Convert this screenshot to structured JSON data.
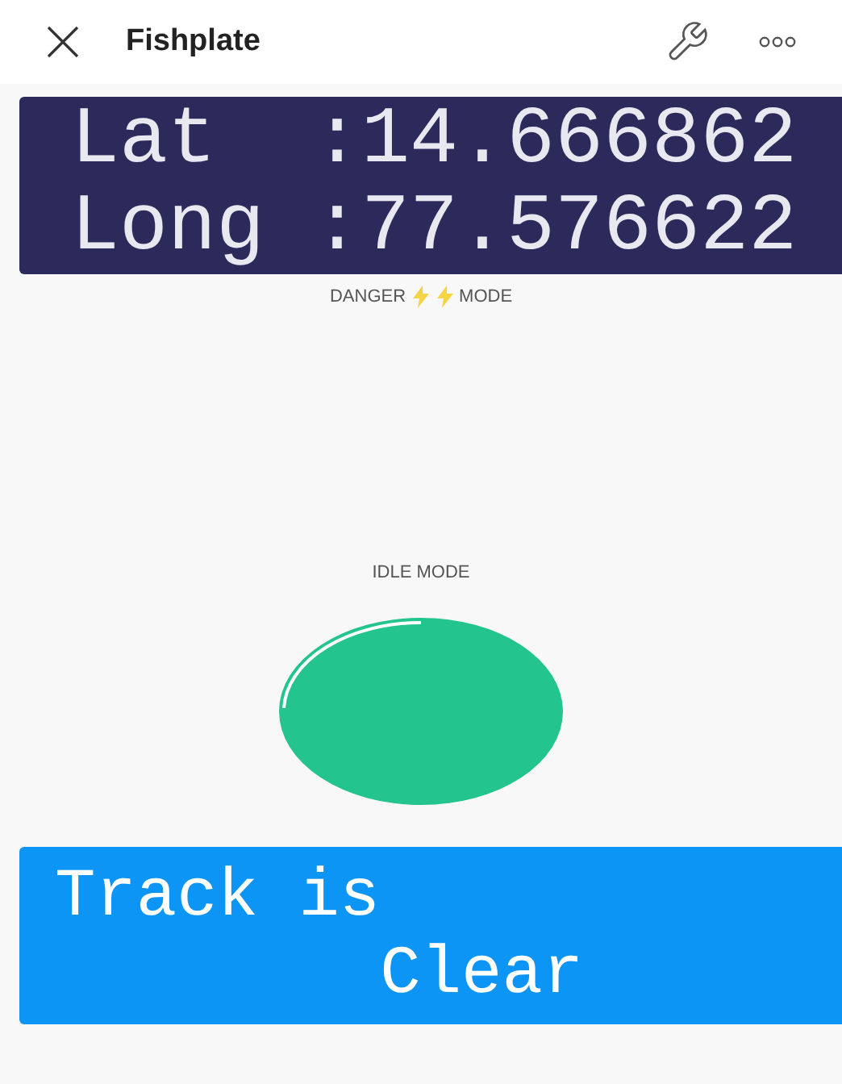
{
  "header": {
    "title": "Fishplate"
  },
  "location_display": {
    "lines": [
      "Lat  :14.666862",
      "Long :77.576622"
    ]
  },
  "danger_led": {
    "label_start": "DANGER",
    "label_end": "MODE"
  },
  "idle_led": {
    "label": "IDLE MODE",
    "color": "#23c48e"
  },
  "status_display": {
    "lines": [
      "Track is",
      "        Clear"
    ]
  }
}
